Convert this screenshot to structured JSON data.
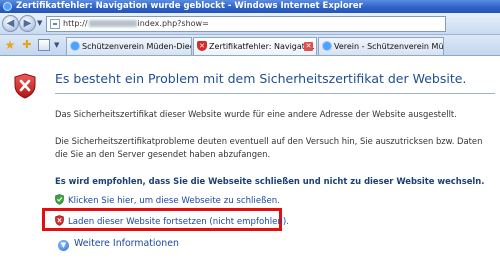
{
  "window": {
    "title": "Zertifikatfehler: Navigation wurde geblockt - Windows Internet Explorer"
  },
  "address": {
    "prefix": "http://",
    "suffix": "index.php?show="
  },
  "tabs": [
    {
      "label": "Schützenverein Müden-Dieck...",
      "active": false
    },
    {
      "label": "Zertifikatfehler: Navigati...",
      "active": true
    },
    {
      "label": "Verein - Schützenverein Müd...",
      "active": false
    }
  ],
  "page": {
    "heading": "Es besteht ein Problem mit dem Sicherheitszertifikat der Website.",
    "para1": "Das Sicherheitszertifikat dieser Website wurde für eine andere Adresse der Website ausgestellt.",
    "para2": "Die Sicherheitszertifikatprobleme deuten eventuell auf den Versuch hin, Sie auszutricksen bzw. Daten die Sie an den Server gesendet haben abzufangen.",
    "recommend": "Es wird empfohlen, dass Sie die Webseite schließen und nicht zu dieser Website wechseln.",
    "link_close": "Klicken Sie hier, um diese Webseite zu schließen.",
    "link_continue": "Laden dieser Website fortsetzen (nicht empfohlen).",
    "more_info": "Weitere Informationen"
  },
  "colors": {
    "accent": "#1f4d96",
    "highlight": "#e50d0d",
    "link": "#1a48a8"
  }
}
